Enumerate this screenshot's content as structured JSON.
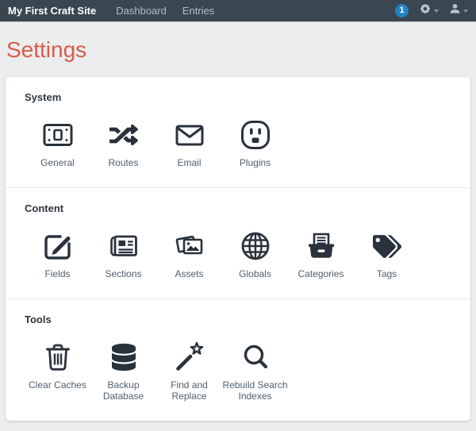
{
  "navbar": {
    "brand": "My First Craft Site",
    "links": [
      {
        "label": "Dashboard"
      },
      {
        "label": "Entries"
      }
    ],
    "updates_badge": {
      "count": "1"
    }
  },
  "page": {
    "title": "Settings"
  },
  "sections": [
    {
      "slug": "system",
      "heading": "System",
      "items": [
        {
          "slug": "general",
          "label": "General",
          "icon": "general-icon"
        },
        {
          "slug": "routes",
          "label": "Routes",
          "icon": "routes-icon"
        },
        {
          "slug": "email",
          "label": "Email",
          "icon": "email-icon"
        },
        {
          "slug": "plugins",
          "label": "Plugins",
          "icon": "plugins-icon"
        }
      ]
    },
    {
      "slug": "content",
      "heading": "Content",
      "items": [
        {
          "slug": "fields",
          "label": "Fields",
          "icon": "fields-icon"
        },
        {
          "slug": "sections",
          "label": "Sections",
          "icon": "sections-icon"
        },
        {
          "slug": "assets",
          "label": "Assets",
          "icon": "assets-icon"
        },
        {
          "slug": "globals",
          "label": "Globals",
          "icon": "globals-icon"
        },
        {
          "slug": "categories",
          "label": "Categories",
          "icon": "categories-icon"
        },
        {
          "slug": "tags",
          "label": "Tags",
          "icon": "tags-icon"
        }
      ]
    },
    {
      "slug": "tools",
      "heading": "Tools",
      "items": [
        {
          "slug": "clear-caches",
          "label": "Clear Caches",
          "icon": "clear-caches-icon"
        },
        {
          "slug": "backup-database",
          "label": "Backup Database",
          "icon": "backup-database-icon"
        },
        {
          "slug": "find-and-replace",
          "label": "Find and Replace",
          "icon": "find-replace-icon"
        },
        {
          "slug": "rebuild-search-indexes",
          "label": "Rebuild Search Indexes",
          "icon": "rebuild-search-icon"
        }
      ]
    }
  ],
  "colors": {
    "topbar_bg": "#3a4650",
    "badge_blue": "#2383c2",
    "title_accent": "#da5a47",
    "icon_dark": "#29323c",
    "page_bg": "#ebedee"
  }
}
